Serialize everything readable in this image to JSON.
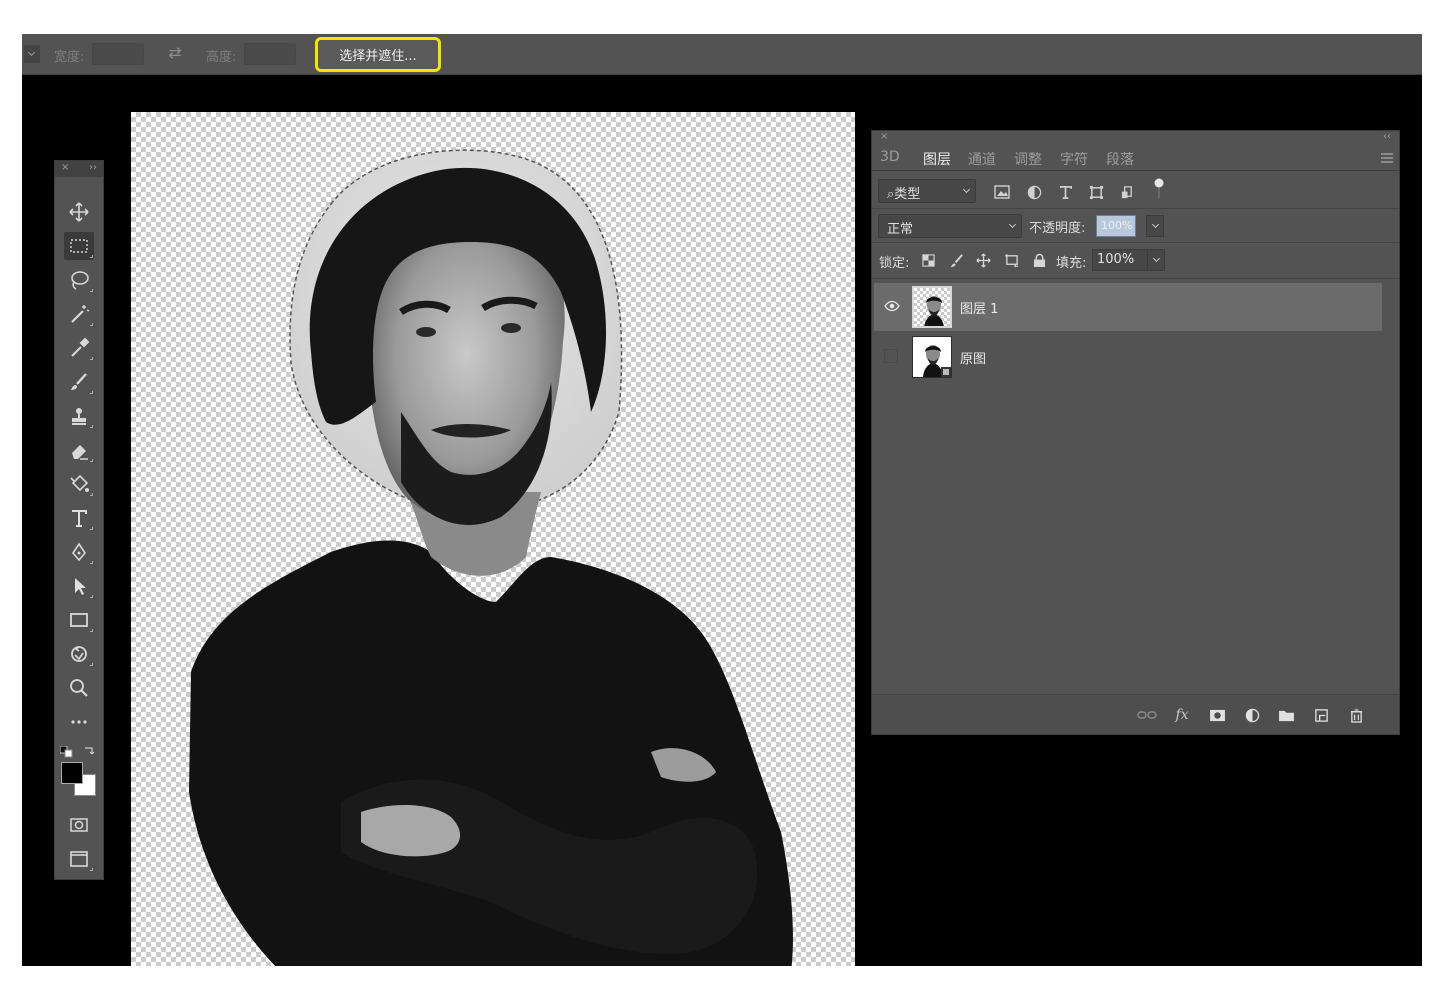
{
  "options_bar": {
    "width_label": "宽度:",
    "height_label": "高度:",
    "select_mask_label": "选择并遮住..."
  },
  "tools_panel": {
    "close": "×",
    "collapse": "››",
    "tools": [
      {
        "name": "move-tool-icon",
        "active": false
      },
      {
        "name": "rectangular-marquee-tool-icon",
        "active": true
      },
      {
        "name": "lasso-tool-icon",
        "active": false
      },
      {
        "name": "magic-wand-tool-icon",
        "active": false
      },
      {
        "name": "eyedropper-tool-icon",
        "active": false
      },
      {
        "name": "brush-tool-icon",
        "active": false
      },
      {
        "name": "clone-stamp-tool-icon",
        "active": false
      },
      {
        "name": "eraser-tool-icon",
        "active": false
      },
      {
        "name": "paint-bucket-tool-icon",
        "active": false
      },
      {
        "name": "type-tool-icon",
        "active": false
      },
      {
        "name": "pen-tool-icon",
        "active": false
      },
      {
        "name": "path-selection-tool-icon",
        "active": false
      },
      {
        "name": "rectangle-tool-icon",
        "active": false
      },
      {
        "name": "rotate-view-tool-icon",
        "active": false
      },
      {
        "name": "zoom-tool-icon",
        "active": false
      },
      {
        "name": "more-tools-icon",
        "active": false
      }
    ],
    "foreground_color": "#000000",
    "background_color": "#ffffff"
  },
  "layers_panel": {
    "close": "×",
    "collapse": "‹‹",
    "tabs": [
      {
        "label": "3D",
        "active": false
      },
      {
        "label": "图层",
        "active": true
      },
      {
        "label": "通道",
        "active": false
      },
      {
        "label": "调整",
        "active": false
      },
      {
        "label": "字符",
        "active": false
      },
      {
        "label": "段落",
        "active": false
      }
    ],
    "filter_kind": "类型",
    "blend_mode": "正常",
    "opacity_label": "不透明度:",
    "opacity_value": "100%",
    "lock_label": "锁定:",
    "fill_label": "填充:",
    "fill_value": "100%",
    "layers": [
      {
        "name": "图层 1",
        "visible": true,
        "selected": true
      },
      {
        "name": "原图",
        "visible": false,
        "selected": false
      }
    ]
  }
}
